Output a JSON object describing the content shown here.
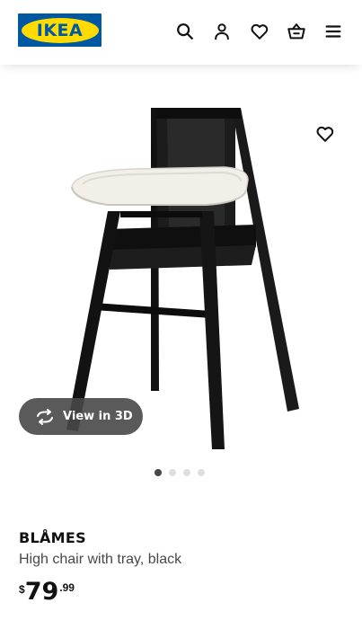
{
  "header": {
    "logo_text": "IKEA",
    "icons": [
      "search-icon",
      "account-icon",
      "heart-icon",
      "basket-icon",
      "menu-icon"
    ]
  },
  "gallery": {
    "view3d_label": "View in 3D",
    "slides_total": 4,
    "active_slide": 1
  },
  "product": {
    "name": "BLÅMES",
    "description": "High chair with tray, black",
    "price_currency": "$",
    "price_integer": "79",
    "price_decimal": ".99"
  },
  "colors": {
    "ikea_blue": "#0058a3",
    "ikea_yellow": "#ffdb00",
    "text": "#111111",
    "muted": "#484848"
  }
}
